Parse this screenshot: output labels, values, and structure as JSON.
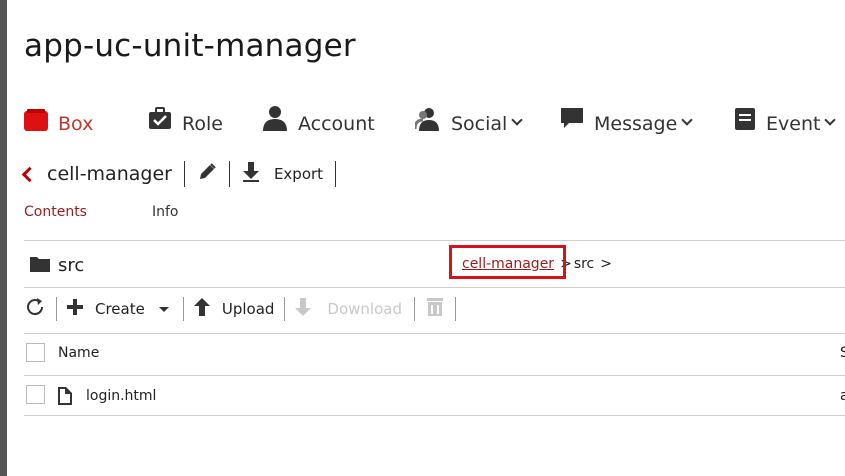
{
  "app": {
    "title": "app-uc-unit-manager"
  },
  "nav": {
    "items": [
      {
        "label": "Box",
        "active": true
      },
      {
        "label": "Role"
      },
      {
        "label": "Account"
      },
      {
        "label": "Social"
      },
      {
        "label": "Message"
      },
      {
        "label": "Event"
      }
    ]
  },
  "cell": {
    "name": "cell-manager",
    "export_label": "Export"
  },
  "subtabs": {
    "contents": "Contents",
    "info": "Info"
  },
  "folder": {
    "name": "src"
  },
  "breadcrumb": {
    "link": "cell-manager",
    "sep1": ">",
    "current": "src",
    "sep2": ">"
  },
  "toolbar": {
    "create": "Create",
    "upload": "Upload",
    "download": "Download"
  },
  "table": {
    "headers": {
      "name": "Name",
      "s": "S"
    },
    "rows": [
      {
        "name": "login.html",
        "s": "a"
      }
    ]
  },
  "colors": {
    "accent": "#9b1c1c",
    "active_nav": "#c0392b",
    "highlight": "#d4141c"
  }
}
